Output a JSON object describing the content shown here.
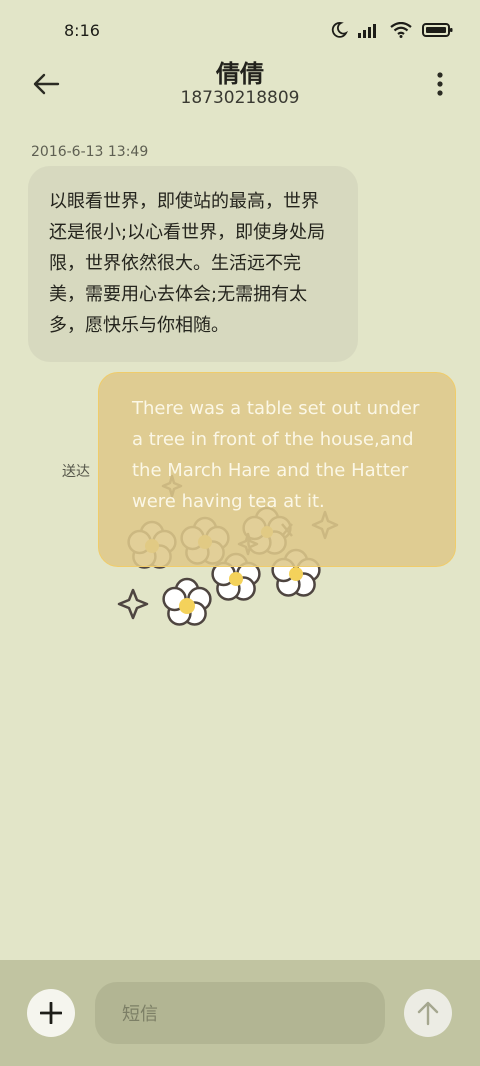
{
  "status_bar": {
    "time": "8:16",
    "icons": [
      "moon-icon",
      "signal-icon",
      "wifi-icon",
      "battery-icon"
    ]
  },
  "header": {
    "contact_name": "倩倩",
    "contact_number": "18730218809"
  },
  "conversation": {
    "timestamp": "2016-6-13 13:49",
    "incoming_message": "以眼看世界，即使站的最高，世界还是很小;以心看世界，即使身处局限，世界依然很大。生活远不完美，需要用心去体会;无需拥有太多，愿快乐与你相随。",
    "outgoing_message": "There was a table set out under a tree in front of the house,and the March Hare and the Hatter were having tea at it.",
    "outgoing_status": "送达"
  },
  "input_bar": {
    "placeholder": "短信"
  },
  "colors": {
    "background": "#e2e5c8",
    "incoming_bubble": "#d7d9bf",
    "outgoing_bubble": "#dec88a",
    "input_bar": "#c1c4a1"
  }
}
